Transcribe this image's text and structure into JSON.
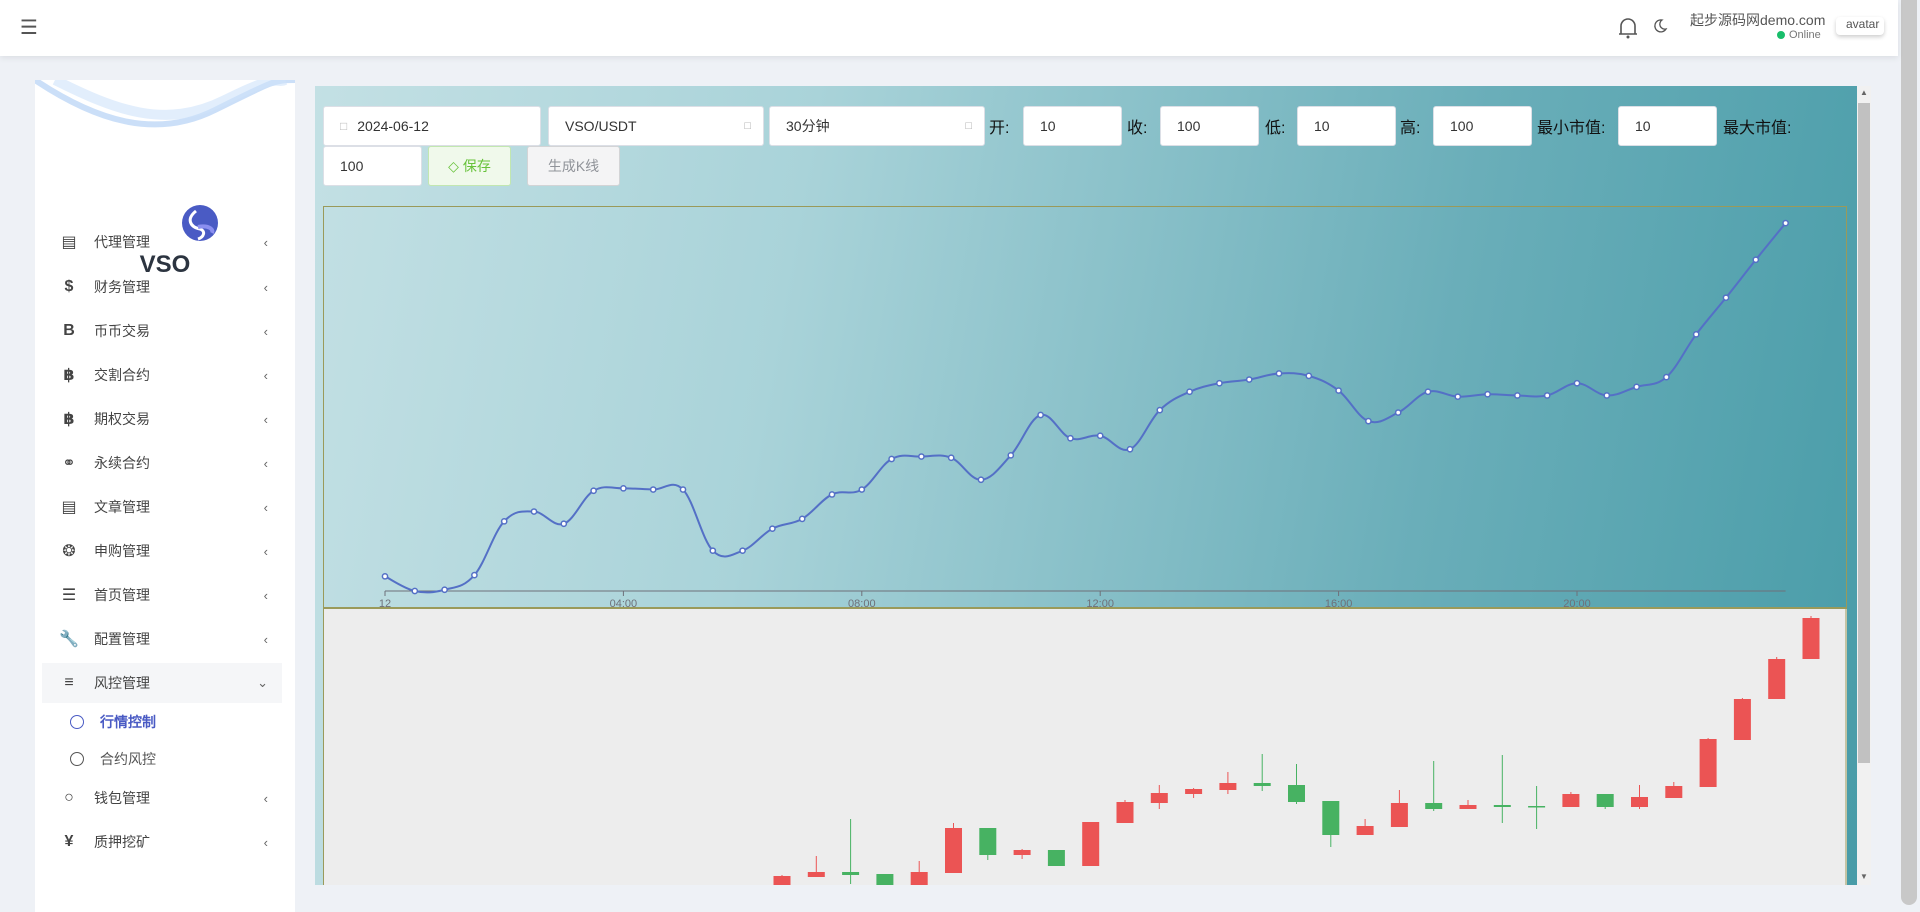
{
  "header": {
    "menu_icon": "hamburger-icon",
    "user_name": "起步源码网demo.com",
    "status": "Online",
    "avatar_alt": "avatar",
    "status_color": "#19be6b"
  },
  "sidebar": {
    "brand": "VSO",
    "items": [
      {
        "label": "代理管理",
        "icon": "id-card-icon"
      },
      {
        "label": "财务管理",
        "icon": "dollar-icon"
      },
      {
        "label": "币币交易",
        "icon": "b-icon"
      },
      {
        "label": "交割合约",
        "icon": "bitcoin-icon"
      },
      {
        "label": "期权交易",
        "icon": "bitcoin-icon"
      },
      {
        "label": "永续合约",
        "icon": "link-icon"
      },
      {
        "label": "文章管理",
        "icon": "newspaper-icon"
      },
      {
        "label": "申购管理",
        "icon": "lifebuoy-icon"
      },
      {
        "label": "首页管理",
        "icon": "list-icon"
      },
      {
        "label": "配置管理",
        "icon": "wrench-icon"
      },
      {
        "label": "风控管理",
        "icon": "indent-icon",
        "expanded": true
      },
      {
        "label": "钱包管理",
        "icon": "circle-icon"
      },
      {
        "label": "质押挖矿",
        "icon": "yen-icon"
      }
    ],
    "subitems": [
      {
        "label": "行情控制",
        "active": true
      },
      {
        "label": "合约风控",
        "active": false
      }
    ],
    "accent": "#4a5bc4"
  },
  "toolbar": {
    "date": "2024-06-12",
    "symbol": "VSO/USDT",
    "period": "30分钟",
    "open_label": "开:",
    "open": "10",
    "close_label": "收:",
    "close": "100",
    "low_label": "低:",
    "low": "10",
    "high_label": "高:",
    "high": "100",
    "min_cap_label": "最小市值:",
    "min_cap": "10",
    "max_cap_label": "最大市值:",
    "max_cap": "100",
    "save_label": "保存",
    "generate_label": "生成K线"
  },
  "chart_data": [
    {
      "type": "line",
      "title": "",
      "x_ticks": [
        "12",
        "04:00",
        "08:00",
        "12:00",
        "16:00",
        "20:00"
      ],
      "ylim": [
        0,
        315
      ],
      "line_color": "#5470c6",
      "values": [
        12,
        0,
        1,
        13,
        57,
        65,
        55,
        82,
        84,
        83,
        83,
        33,
        33,
        51,
        59,
        79,
        83,
        108,
        110,
        109,
        91,
        111,
        144,
        125,
        127,
        116,
        148,
        163,
        170,
        173,
        178,
        176,
        164,
        139,
        146,
        163,
        159,
        161,
        160,
        160,
        170,
        160,
        167,
        175,
        210,
        240,
        271,
        301
      ]
    },
    {
      "type": "candlestick",
      "ylim": [
        0,
        277
      ],
      "up_color": "#eb5454",
      "down_color": "#47b262",
      "candles": [
        [
          -15,
          9,
          10,
          -15
        ],
        [
          8,
          13,
          29,
          8
        ],
        [
          13,
          10,
          66,
          1
        ],
        [
          11,
          -15,
          11,
          -15
        ],
        [
          -15,
          13,
          24,
          -15
        ],
        [
          12,
          57,
          62,
          12
        ],
        [
          57,
          30,
          57,
          25
        ],
        [
          30,
          35,
          36,
          26
        ],
        [
          35,
          19,
          35,
          19
        ],
        [
          19,
          63,
          63,
          19
        ],
        [
          62,
          83,
          85,
          62
        ],
        [
          82,
          92,
          100,
          76
        ],
        [
          91,
          96,
          97,
          87
        ],
        [
          95,
          102,
          113,
          91
        ],
        [
          102,
          99,
          131,
          94
        ],
        [
          100,
          83,
          121,
          81
        ],
        [
          84,
          50,
          84,
          38
        ],
        [
          50,
          59,
          66,
          50
        ],
        [
          58,
          82,
          95,
          58
        ],
        [
          82,
          76,
          124,
          74
        ],
        [
          76,
          80,
          85,
          76
        ],
        [
          80,
          78,
          130,
          62
        ],
        [
          79,
          78,
          99,
          56
        ],
        [
          78,
          91,
          93,
          78
        ],
        [
          91,
          78,
          91,
          76
        ],
        [
          78,
          88,
          100,
          76
        ],
        [
          87,
          99,
          103,
          87
        ],
        [
          98,
          146,
          147,
          98
        ],
        [
          145,
          186,
          187,
          145
        ],
        [
          186,
          226,
          228,
          186
        ],
        [
          226,
          267,
          269,
          226
        ]
      ]
    }
  ]
}
